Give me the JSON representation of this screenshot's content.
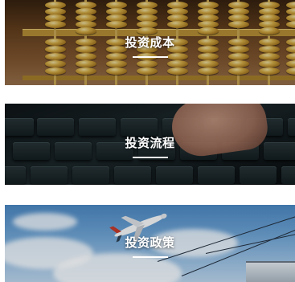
{
  "cards": [
    {
      "title": "投资成本"
    },
    {
      "title": "投资流程"
    },
    {
      "title": "投资政策"
    }
  ]
}
